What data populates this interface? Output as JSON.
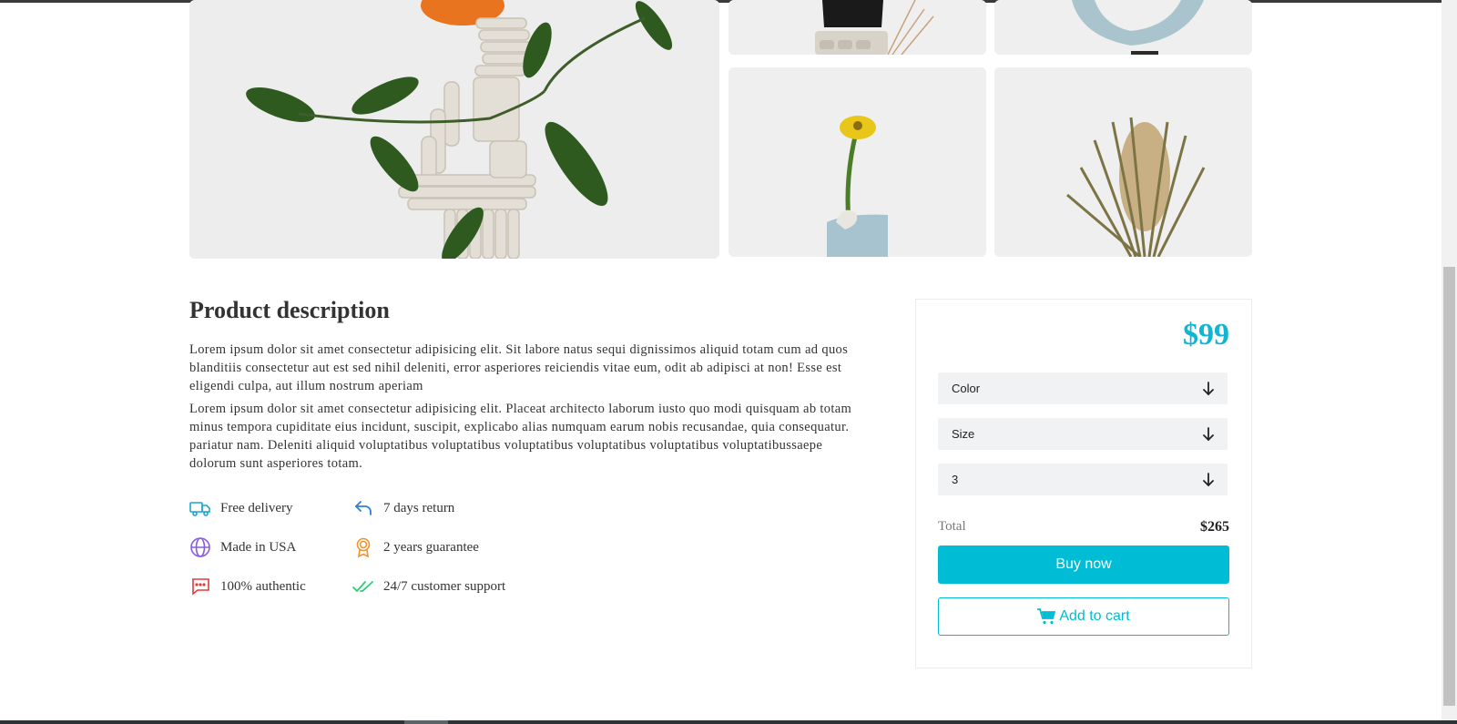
{
  "gallery": {
    "main_image_icon": "sculpture-with-orange-image",
    "thumbnails": [
      "black-vase-dried-flowers-image",
      "blue-vase-image",
      "yellow-flower-vase-image",
      "dried-banksia-image"
    ]
  },
  "description": {
    "title": "Product description",
    "paragraph1": "Lorem ipsum dolor sit amet consectetur adipisicing elit. Sit labore natus sequi dignissimos aliquid totam cum ad quos blanditiis consectetur aut est sed nihil deleniti, error asperiores reiciendis vitae eum, odit ab adipisci at non! Esse est eligendi culpa, aut illum nostrum aperiam",
    "paragraph2": "Lorem ipsum dolor sit amet consectetur adipisicing elit. Placeat architecto laborum iusto quo modi quisquam ab totam minus tempora cupiditate eius incidunt, suscipit, explicabo alias numquam earum nobis recusandae, quia consequatur. pariatur nam. Deleniti aliquid voluptatibus voluptatibus voluptatibus voluptatibus voluptatibus voluptatibussaepe dolorum sunt asperiores totam."
  },
  "features": [
    {
      "label": "Free delivery",
      "icon": "truck-icon",
      "color": "#1aa7d6"
    },
    {
      "label": "7 days return",
      "icon": "return-arrow-icon",
      "color": "#2f7fd8"
    },
    {
      "label": "Made in USA",
      "icon": "globe-icon",
      "color": "#8a5ce0"
    },
    {
      "label": "2 years guarantee",
      "icon": "award-icon",
      "color": "#f0932b"
    },
    {
      "label": "100% authentic",
      "icon": "chat-dots-icon",
      "color": "#e03b3b"
    },
    {
      "label": "24/7 customer support",
      "icon": "double-check-icon",
      "color": "#2ecc71"
    }
  ],
  "purchase": {
    "price": "$99",
    "color_select": "Color",
    "size_select": "Size",
    "quantity_select": "3",
    "total_label": "Total",
    "total_value": "$265",
    "buy_label": "Buy now",
    "cart_label": "Add to cart",
    "accent_color": "#00bcd4"
  }
}
